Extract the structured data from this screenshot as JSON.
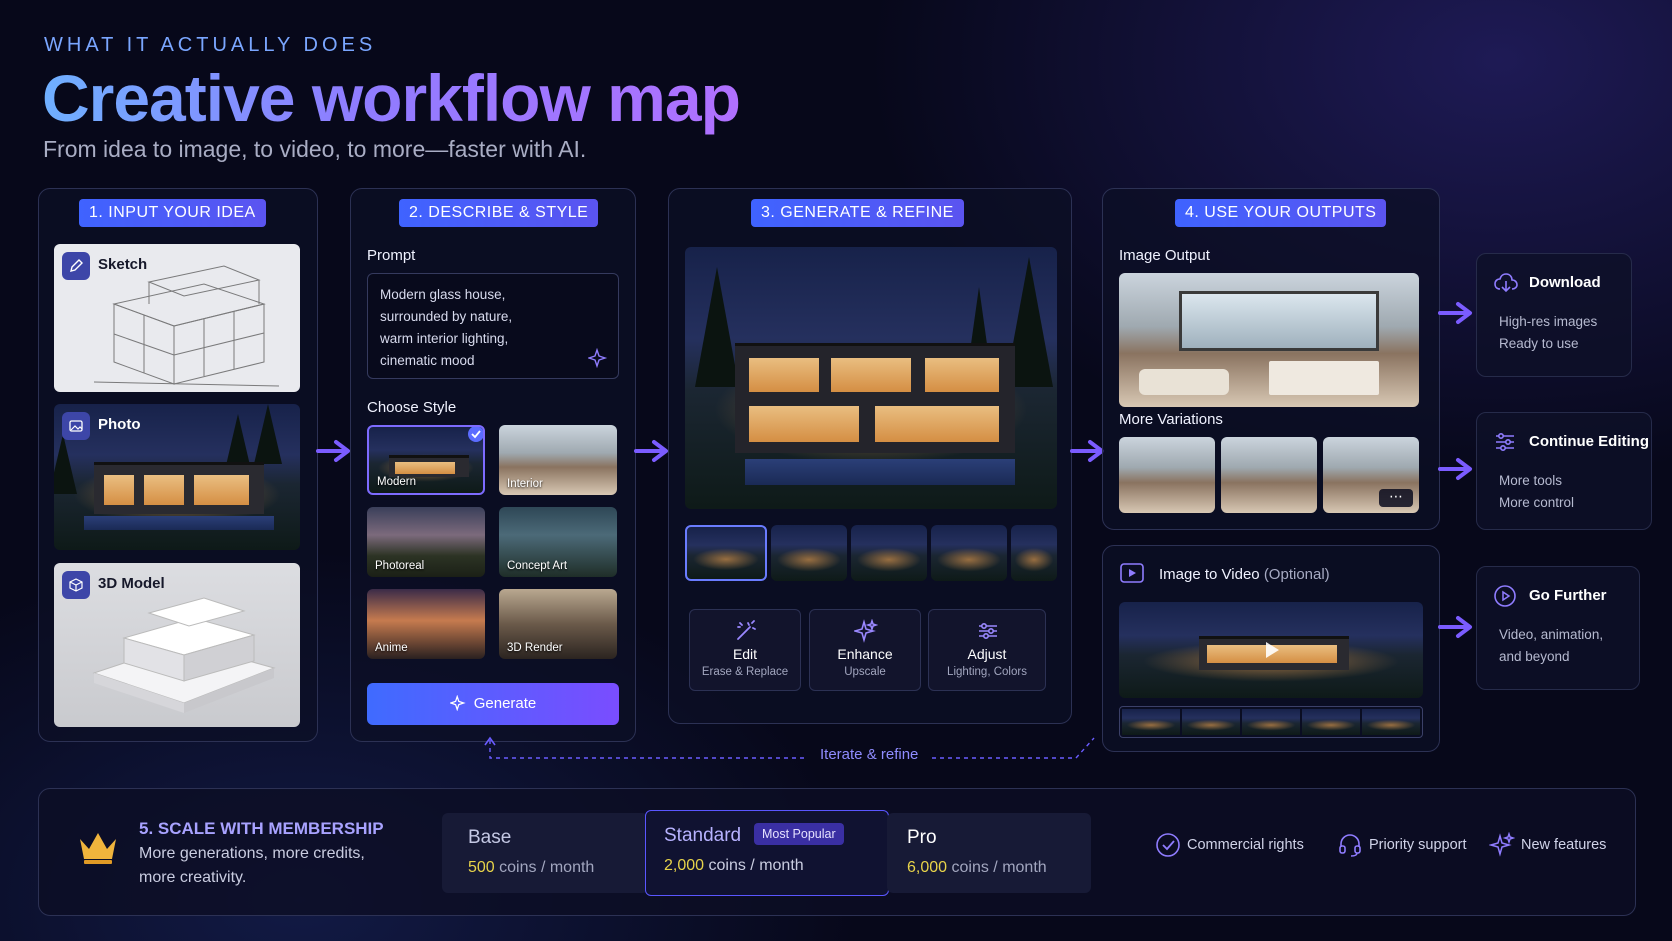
{
  "header": {
    "eyebrow": "WHAT IT ACTUALLY DOES",
    "title": "Creative workflow map",
    "subtitle": "From idea to image, to video, to more—faster with AI."
  },
  "step1": {
    "tag": "1. INPUT YOUR IDEA",
    "inputs": [
      {
        "label": "Sketch",
        "icon": "pencil-icon"
      },
      {
        "label": "Photo",
        "icon": "image-icon"
      },
      {
        "label": "3D Model",
        "icon": "cube-icon"
      }
    ]
  },
  "step2": {
    "tag": "2. DESCRIBE & STYLE",
    "prompt_label": "Prompt",
    "prompt_lines": [
      "Modern glass house,",
      "surrounded by nature,",
      "warm interior lighting,",
      "cinematic mood"
    ],
    "style_label": "Choose Style",
    "styles": [
      "Modern",
      "Interior",
      "Photoreal",
      "Concept Art",
      "Anime",
      "3D Render"
    ],
    "selected_style": "Modern",
    "generate_label": "Generate"
  },
  "step3": {
    "tag": "3. GENERATE & REFINE",
    "tools": [
      {
        "title": "Edit",
        "sub": "Erase & Replace",
        "icon": "magic-wand-icon"
      },
      {
        "title": "Enhance",
        "sub": "Upscale",
        "icon": "sparkle-icon"
      },
      {
        "title": "Adjust",
        "sub": "Lighting, Colors",
        "icon": "sliders-icon"
      }
    ]
  },
  "step4": {
    "tag": "4. USE YOUR OUTPUTS",
    "image_output_label": "Image Output",
    "variations_label": "More Variations",
    "more_icon": "more-dots-icon",
    "video_label": "Image to Video",
    "video_optional": "(Optional)"
  },
  "iterate_label": "Iterate & refine",
  "side_cards": [
    {
      "title": "Download",
      "lines": [
        "High-res images",
        "Ready to use"
      ],
      "icon": "cloud-download-icon"
    },
    {
      "title": "Continue Editing",
      "lines": [
        "More tools",
        "More control"
      ],
      "icon": "sliders-icon"
    },
    {
      "title": "Go Further",
      "lines": [
        "Video, animation,",
        "and beyond"
      ],
      "icon": "play-circle-icon"
    }
  ],
  "membership": {
    "title": "5. SCALE WITH MEMBERSHIP",
    "desc_line1": "More generations, more credits,",
    "desc_line2": "more creativity.",
    "plans": [
      {
        "name": "Base",
        "amount": "500",
        "unit": "coins / month"
      },
      {
        "name": "Standard",
        "amount": "2,000",
        "unit": "coins / month",
        "badge": "Most Popular"
      },
      {
        "name": "Pro",
        "amount": "6,000",
        "unit": "coins / month"
      }
    ],
    "features": [
      {
        "label": "Commercial rights",
        "icon": "check-circle-icon"
      },
      {
        "label": "Priority support",
        "icon": "headset-icon"
      },
      {
        "label": "New features",
        "icon": "sparkle-icon"
      }
    ]
  },
  "colors": {
    "accent": "#5b54f0",
    "arrow": "#7b5cff",
    "gold": "#e7d34a"
  }
}
